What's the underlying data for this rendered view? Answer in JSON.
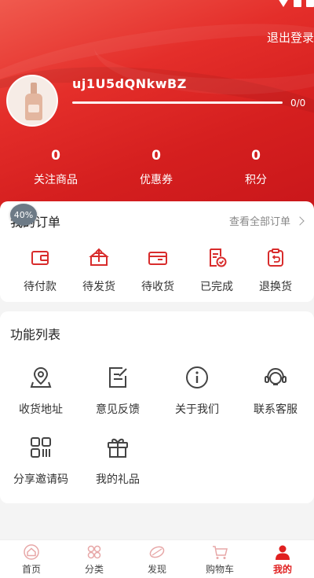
{
  "header": {
    "logout_label": "退出登录",
    "username": "uj1U5dQNkwBZ",
    "progress_text": "0/0",
    "progress": 0
  },
  "stats": [
    {
      "value": "0",
      "label": "关注商品"
    },
    {
      "value": "0",
      "label": "优惠券"
    },
    {
      "value": "0",
      "label": "积分"
    }
  ],
  "badge": "40%",
  "orders": {
    "title": "我的订单",
    "view_all": "查看全部订单",
    "items": [
      {
        "label": "待付款",
        "icon": "wallet-icon"
      },
      {
        "label": "待发货",
        "icon": "package-upload-icon"
      },
      {
        "label": "待收货",
        "icon": "delivery-box-icon"
      },
      {
        "label": "已完成",
        "icon": "completed-document-icon"
      },
      {
        "label": "退换货",
        "icon": "return-clipboard-icon"
      }
    ]
  },
  "features": {
    "title": "功能列表",
    "items": [
      {
        "label": "收货地址",
        "icon": "location-pin-icon"
      },
      {
        "label": "意见反馈",
        "icon": "feedback-edit-icon"
      },
      {
        "label": "关于我们",
        "icon": "info-circle-icon"
      },
      {
        "label": "联系客服",
        "icon": "headset-icon"
      },
      {
        "label": "分享邀请码",
        "icon": "qr-code-icon"
      },
      {
        "label": "我的礼品",
        "icon": "gift-icon"
      }
    ]
  },
  "tabbar": [
    {
      "label": "首页",
      "icon": "home-icon",
      "active": false
    },
    {
      "label": "分类",
      "icon": "category-icon",
      "active": false
    },
    {
      "label": "发现",
      "icon": "discover-icon",
      "active": false
    },
    {
      "label": "购物车",
      "icon": "cart-icon",
      "active": false
    },
    {
      "label": "我的",
      "icon": "profile-icon",
      "active": true
    }
  ],
  "colors": {
    "accent": "#e02020",
    "header_red": "#d51f1f",
    "icon_stroke": "#444444",
    "order_icon_red": "#d82c2c"
  }
}
